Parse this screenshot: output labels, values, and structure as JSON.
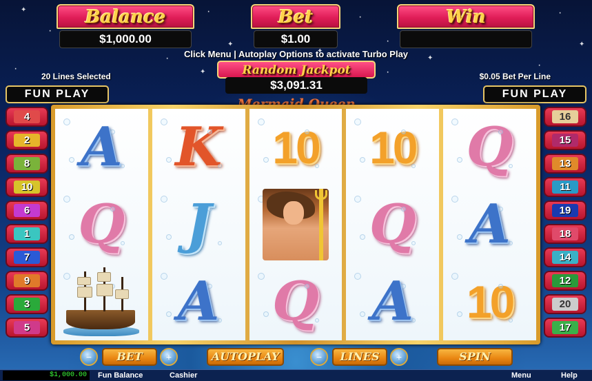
{
  "meters": {
    "balance": {
      "title": "Balance",
      "value": "$1,000.00"
    },
    "bet": {
      "title": "Bet",
      "value": "$1.00"
    },
    "win": {
      "title": "Win",
      "value": ""
    }
  },
  "info": {
    "turbo_message": "Click Menu | Autoplay Options to activate Turbo Play",
    "lines_selected": "20 Lines Selected",
    "bet_per_line": "$0.05 Bet Per Line"
  },
  "jackpot": {
    "title": "Random Jackpot",
    "value": "$3,091.31"
  },
  "fun_play": {
    "left": "FUN PLAY",
    "right": "FUN PLAY"
  },
  "game_logo": "Mermaid Queen",
  "reels": [
    [
      "A",
      "Q",
      "ship"
    ],
    [
      "K",
      "J",
      "A"
    ],
    [
      "10",
      "neptune",
      "Q"
    ],
    [
      "10",
      "Q",
      "A"
    ],
    [
      "Q",
      "A",
      "10"
    ]
  ],
  "paylines": {
    "left": [
      {
        "n": "4",
        "color": "#e04a4a"
      },
      {
        "n": "2",
        "color": "#e6b52a"
      },
      {
        "n": "8",
        "color": "#7ab33a"
      },
      {
        "n": "10",
        "color": "#d6c42a"
      },
      {
        "n": "6",
        "color": "#c43ad0"
      },
      {
        "n": "1",
        "color": "#3ac6c0"
      },
      {
        "n": "7",
        "color": "#2a5ad6"
      },
      {
        "n": "9",
        "color": "#e07a2a"
      },
      {
        "n": "3",
        "color": "#2aaa3a"
      },
      {
        "n": "5",
        "color": "#d03a8a"
      }
    ],
    "right": [
      {
        "n": "16",
        "color": "#e6cf9a"
      },
      {
        "n": "15",
        "color": "#b02a6a"
      },
      {
        "n": "13",
        "color": "#e08a2a"
      },
      {
        "n": "11",
        "color": "#2a9ac6"
      },
      {
        "n": "19",
        "color": "#1a3ab0"
      },
      {
        "n": "18",
        "color": "#e04a6a"
      },
      {
        "n": "14",
        "color": "#3ab0c6"
      },
      {
        "n": "12",
        "color": "#2a9a3a"
      },
      {
        "n": "20",
        "color": "#cccccc"
      },
      {
        "n": "17",
        "color": "#3ab04a"
      }
    ]
  },
  "controls": {
    "bet": "BET",
    "autoplay": "AUTOPLAY",
    "lines": "LINES",
    "spin": "SPIN"
  },
  "status": {
    "balance": "$1,000.00",
    "fun_balance": "Fun Balance",
    "cashier": "Cashier",
    "menu": "Menu",
    "help": "Help"
  }
}
